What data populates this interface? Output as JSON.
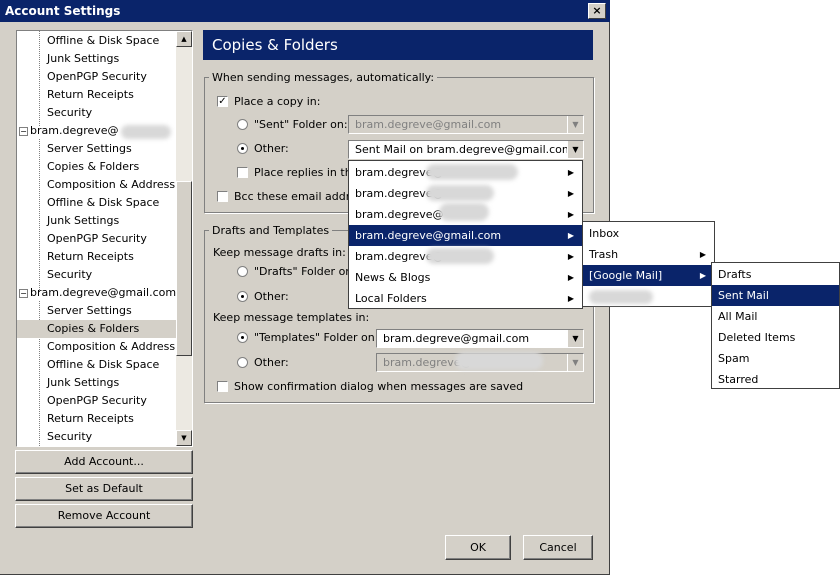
{
  "window": {
    "title": "Account Settings",
    "close": "×"
  },
  "tree": {
    "items": [
      {
        "label": "Offline & Disk Space",
        "type": "child"
      },
      {
        "label": "Junk Settings",
        "type": "child"
      },
      {
        "label": "OpenPGP Security",
        "type": "child"
      },
      {
        "label": "Return Receipts",
        "type": "child"
      },
      {
        "label": "Security",
        "type": "child"
      },
      {
        "label": "bram.degreve@",
        "type": "account"
      },
      {
        "label": "Server Settings",
        "type": "child"
      },
      {
        "label": "Copies & Folders",
        "type": "child"
      },
      {
        "label": "Composition & Addressing",
        "type": "child"
      },
      {
        "label": "Offline & Disk Space",
        "type": "child"
      },
      {
        "label": "Junk Settings",
        "type": "child"
      },
      {
        "label": "OpenPGP Security",
        "type": "child"
      },
      {
        "label": "Return Receipts",
        "type": "child"
      },
      {
        "label": "Security",
        "type": "child"
      },
      {
        "label": "bram.degreve@gmail.com",
        "type": "account"
      },
      {
        "label": "Server Settings",
        "type": "child"
      },
      {
        "label": "Copies & Folders",
        "type": "child",
        "selected": true
      },
      {
        "label": "Composition & Addressing",
        "type": "child"
      },
      {
        "label": "Offline & Disk Space",
        "type": "child"
      },
      {
        "label": "Junk Settings",
        "type": "child"
      },
      {
        "label": "OpenPGP Security",
        "type": "child"
      },
      {
        "label": "Return Receipts",
        "type": "child"
      },
      {
        "label": "Security",
        "type": "child"
      }
    ],
    "collapse_glyph": "−",
    "scroll_up": "▲",
    "scroll_down": "▼"
  },
  "buttons": {
    "add_account": "Add Account...",
    "set_default": "Set as Default",
    "remove_account": "Remove Account",
    "ok": "OK",
    "cancel": "Cancel"
  },
  "panel": {
    "title": "Copies & Folders",
    "sending_group": "When sending messages, automatically:",
    "place_copy": "Place a copy in:",
    "sent_folder": "\"Sent\" Folder on:",
    "sent_folder_value": "bram.degreve@gmail.com",
    "other": "Other:",
    "other_value": "Sent Mail on bram.degreve@gmail.com",
    "place_replies": "Place replies in the f",
    "bcc": "Bcc these email addresse",
    "drafts_group": "Drafts and Templates",
    "keep_drafts": "Keep message drafts in:",
    "drafts_folder": "\"Drafts\" Folder on:",
    "drafts_other": "Other:",
    "keep_templates": "Keep message templates in:",
    "templates_folder": "\"Templates\" Folder on:",
    "templates_value": "bram.degreve@gmail.com",
    "templates_other": "Other:",
    "templates_other_value": "bram.degreve@",
    "show_confirm": "Show confirmation dialog when messages are saved",
    "check_glyph": "✓",
    "arrow_glyph": "▼"
  },
  "menu1": {
    "items": [
      {
        "label": "bram.degreve@"
      },
      {
        "label": "bram.degreve@"
      },
      {
        "label": "bram.degreve@"
      },
      {
        "label": "bram.degreve@gmail.com",
        "highlighted": true
      },
      {
        "label": "bram.degreve@"
      },
      {
        "label": "News & Blogs"
      },
      {
        "label": "Local Folders"
      }
    ],
    "submenu_glyph": "▶"
  },
  "menu2": {
    "items": [
      {
        "label": "Inbox"
      },
      {
        "label": "Trash"
      },
      {
        "label": "[Google Mail]",
        "highlighted": true
      },
      {
        "label": ""
      }
    ]
  },
  "menu3": {
    "items": [
      {
        "label": "Drafts"
      },
      {
        "label": "Sent Mail",
        "highlighted": true
      },
      {
        "label": "All Mail"
      },
      {
        "label": "Deleted Items"
      },
      {
        "label": "Spam"
      },
      {
        "label": "Starred"
      }
    ]
  },
  "colors": {
    "title_bar": "#0a246a",
    "dialog_bg": "#d4d0c8",
    "highlight": "#0a246a"
  }
}
